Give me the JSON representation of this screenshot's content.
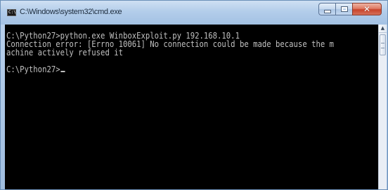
{
  "window": {
    "title": "C:\\Windows\\system32\\cmd.exe",
    "icon": "cmd-console-icon",
    "icon_text": "C:\\"
  },
  "caption_buttons": {
    "minimize_icon": "minimize-icon",
    "maximize_icon": "maximize-icon",
    "close_icon": "close-icon",
    "close_glyph": "✕",
    "close_color": "#c8442b"
  },
  "console": {
    "background": "#000000",
    "text_color": "#c0c0c0",
    "lines": [
      "C:\\Python27>python.exe WinboxExploit.py 192.168.10.1",
      "Connection error: [Errno 10061] No connection could be made because the m",
      "achine actively refused it",
      "",
      "C:\\Python27>"
    ]
  },
  "scrollbar": {
    "up_arrow": "▲"
  }
}
